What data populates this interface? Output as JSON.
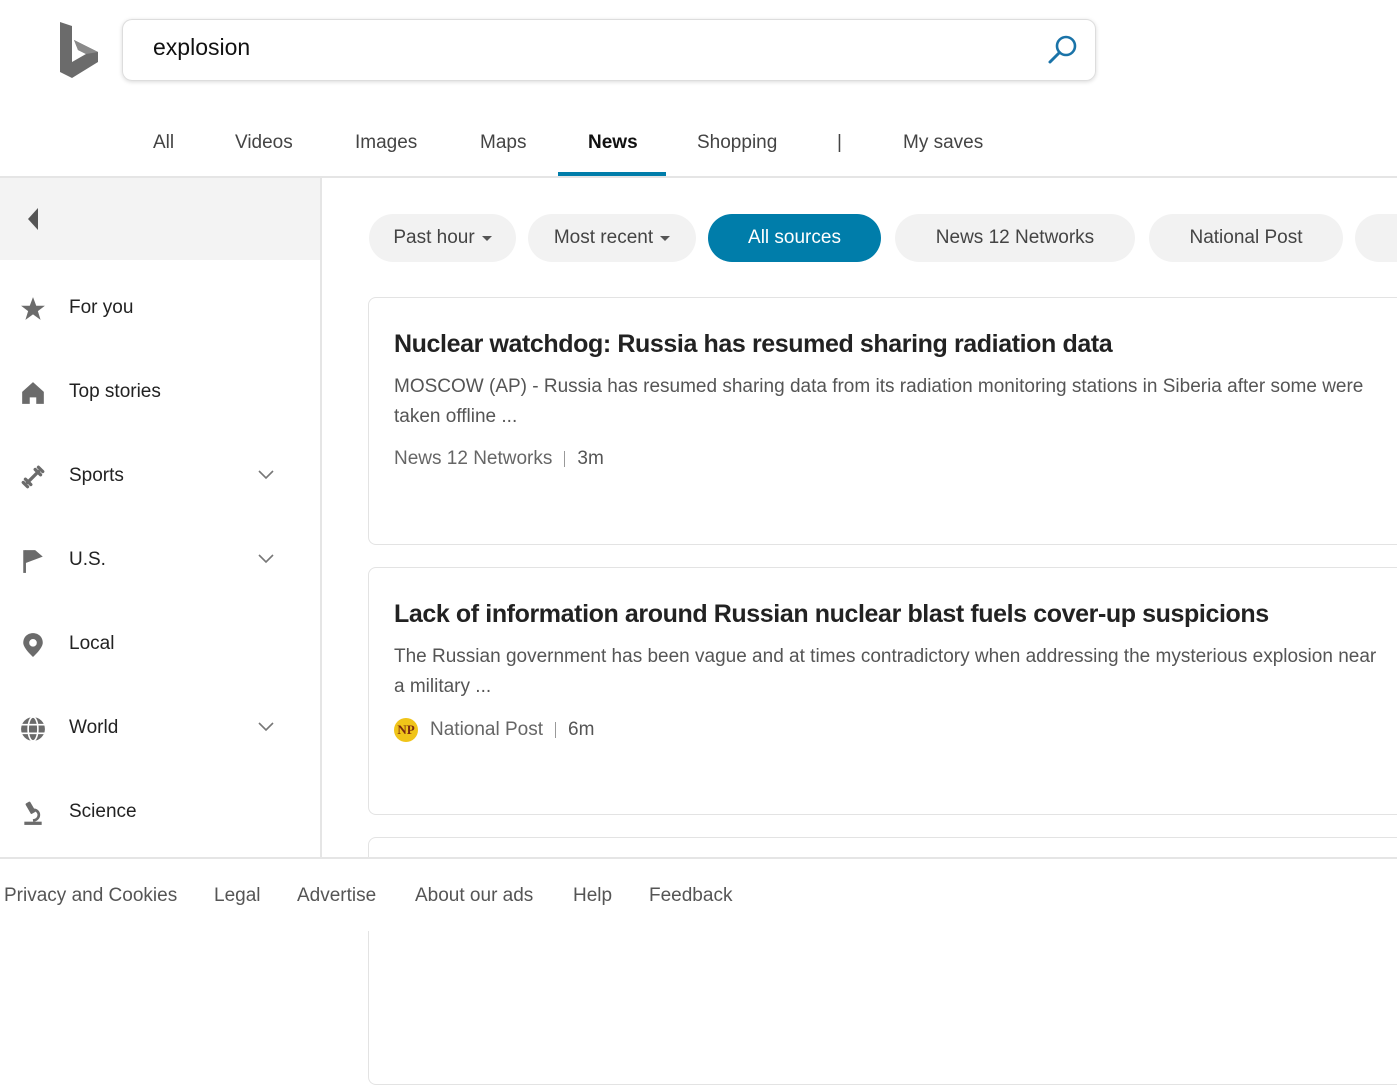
{
  "search": {
    "query": "explosion"
  },
  "tabs": [
    "All",
    "Videos",
    "Images",
    "Maps",
    "News",
    "Shopping",
    "|",
    "My saves"
  ],
  "active_tab": "News",
  "sidebar": {
    "items": [
      {
        "label": "For you",
        "icon": "star-icon",
        "expandable": false
      },
      {
        "label": "Top stories",
        "icon": "home-icon",
        "expandable": false
      },
      {
        "label": "Sports",
        "icon": "dumbbell-icon",
        "expandable": true
      },
      {
        "label": "U.S.",
        "icon": "flag-icon",
        "expandable": true
      },
      {
        "label": "Local",
        "icon": "location-pin-icon",
        "expandable": false
      },
      {
        "label": "World",
        "icon": "globe-icon",
        "expandable": true
      },
      {
        "label": "Science",
        "icon": "microscope-icon",
        "expandable": false
      }
    ]
  },
  "filters": {
    "time": "Past hour",
    "sort": "Most recent",
    "sources": [
      "All sources",
      "News 12 Networks",
      "National Post"
    ],
    "active_source": "All sources"
  },
  "articles": [
    {
      "title": "Nuclear watchdog: Russia has resumed sharing radiation data",
      "snippet": "MOSCOW (AP) - Russia has resumed sharing data from its radiation monitoring stations in Siberia after some were taken offline ...",
      "source": "News 12 Networks",
      "time": "3m"
    },
    {
      "title": "Lack of information around Russian nuclear blast fuels cover-up suspicions",
      "snippet": "The Russian government has been vague and at times contradictory when addressing the mysterious explosion near a military ...",
      "source": "National Post",
      "source_logo": "NP",
      "time": "6m"
    }
  ],
  "footer": [
    "Privacy and Cookies",
    "Legal",
    "Advertise",
    "About our ads",
    "Help",
    "Feedback"
  ],
  "colors": {
    "accent": "#007daa",
    "np_logo": "#f0c419"
  }
}
